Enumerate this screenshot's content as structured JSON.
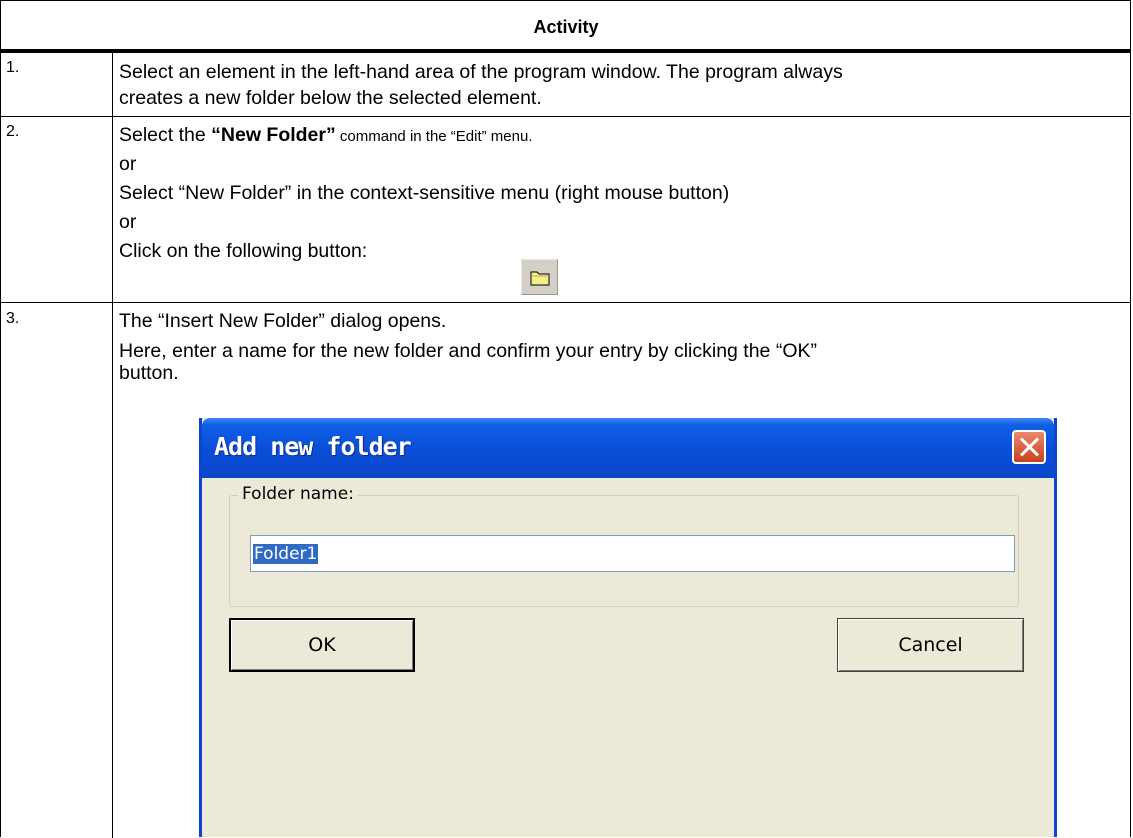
{
  "table": {
    "header": "Activity",
    "rows": [
      {
        "num": "1.",
        "lines": [
          "Select an element in the left-hand area of the program window. The program always",
          "creates a new folder below the selected element."
        ]
      },
      {
        "num": "2.",
        "line1_pre": "Select the ",
        "line1_bold": "“New Folder”",
        "line1_post": " command in the “Edit” menu.",
        "or1": "or",
        "line2": "Select “New Folder” in the context-sensitive menu (right mouse button)",
        "or2": "or",
        "line3": "Click on the following button:"
      },
      {
        "num": "3.",
        "line1": "The “Insert New Folder” dialog opens.",
        "line2": "Here, enter a name for the new folder and confirm your entry by clicking the “OK”",
        "line3": "button."
      }
    ]
  },
  "toolbar_button": {
    "icon": "folder-icon"
  },
  "dialog": {
    "title": "Add new folder",
    "group_label": "Folder name:",
    "input_value": "Folder1",
    "ok_label": "OK",
    "cancel_label": "Cancel"
  },
  "colors": {
    "titlebar": "#0a4fd8",
    "dialog_bg": "#ece9d8",
    "close_button": "#c8401d",
    "selection": "#316ac5"
  }
}
